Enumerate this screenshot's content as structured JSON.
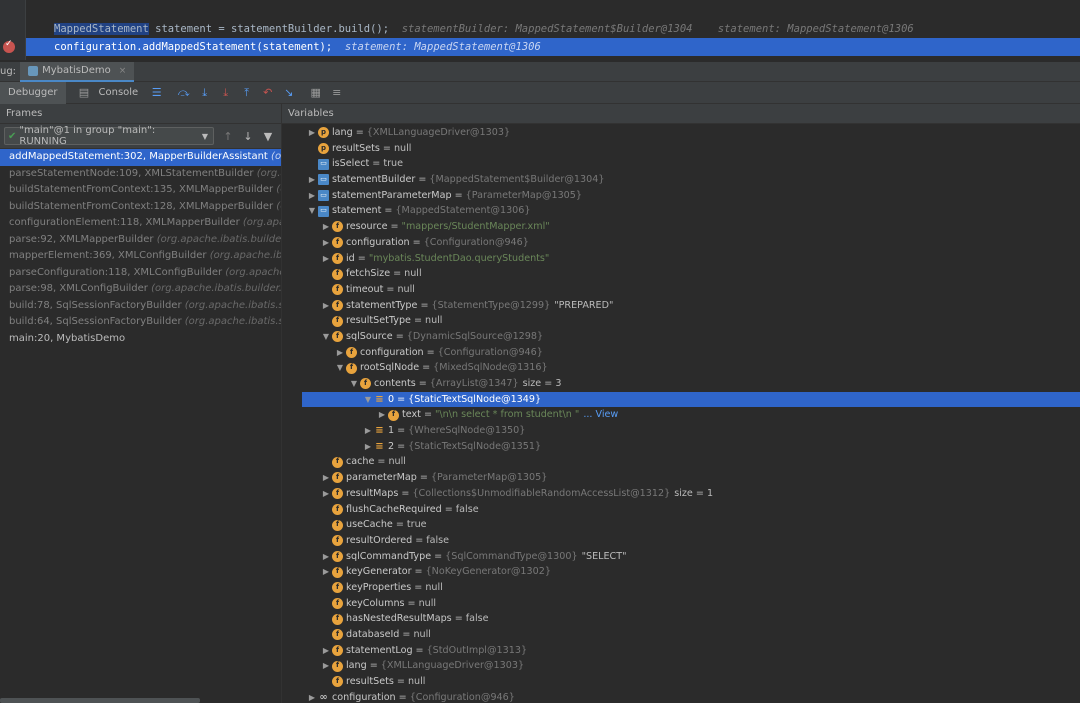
{
  "editor": {
    "line1": {
      "type": "MappedStatement",
      "code": " statement = statementBuilder.build();",
      "hint": "  statementBuilder: MappedStatement$Builder@1304    statement: MappedStatement@1306"
    },
    "line2": {
      "receiver": "configuration",
      "dot": ".",
      "method": "addMappedStatement",
      "args": "(statement);",
      "hint": "  statement: MappedStatement@1306"
    }
  },
  "debug": {
    "label": "ug:",
    "run_tab": "MybatisDemo",
    "close": "×"
  },
  "toolbar": {
    "debugger": "Debugger",
    "console": "Console"
  },
  "frames": {
    "header": "Frames",
    "thread": "\"main\"@1 in group \"main\": RUNNING",
    "items": [
      {
        "method": "addMappedStatement:302, MapperBuilderAssistant",
        "pkg": "(org.ap"
      },
      {
        "method": "parseStatementNode:109, XMLStatementBuilder",
        "pkg": "(org.apach"
      },
      {
        "method": "buildStatementFromContext:135, XMLMapperBuilder",
        "pkg": "(org.a"
      },
      {
        "method": "buildStatementFromContext:128, XMLMapperBuilder",
        "pkg": "(org.a"
      },
      {
        "method": "configurationElement:118, XMLMapperBuilder",
        "pkg": "(org.apache."
      },
      {
        "method": "parse:92, XMLMapperBuilder",
        "pkg": "(org.apache.ibatis.builder.xml"
      },
      {
        "method": "mapperElement:369, XMLConfigBuilder",
        "pkg": "(org.apache.ibatis.b"
      },
      {
        "method": "parseConfiguration:118, XMLConfigBuilder",
        "pkg": "(org.apache.ibat"
      },
      {
        "method": "parse:98, XMLConfigBuilder",
        "pkg": "(org.apache.ibatis.builder.xml)"
      },
      {
        "method": "build:78, SqlSessionFactoryBuilder",
        "pkg": "(org.apache.ibatis.sessio"
      },
      {
        "method": "build:64, SqlSessionFactoryBuilder",
        "pkg": "(org.apache.ibatis.sessio"
      },
      {
        "method": "main:20, MybatisDemo",
        "pkg": ""
      }
    ]
  },
  "variables": {
    "header": "Variables",
    "rows": [
      {
        "name": "lang",
        "value": "{XMLLanguageDriver@1303}"
      },
      {
        "name": "resultSets",
        "value": "null"
      },
      {
        "name": "isSelect",
        "value": "true"
      },
      {
        "name": "statementBuilder",
        "value": "{MappedStatement$Builder@1304}"
      },
      {
        "name": "statementParameterMap",
        "value": "{ParameterMap@1305}"
      },
      {
        "name": "statement",
        "value": "{MappedStatement@1306}"
      },
      {
        "name": "resource",
        "value": "\"mappers/StudentMapper.xml\""
      },
      {
        "name": "configuration",
        "value": "{Configuration@946}"
      },
      {
        "name": "id",
        "value": "\"mybatis.StudentDao.queryStudents\""
      },
      {
        "name": "fetchSize",
        "value": "null"
      },
      {
        "name": "timeout",
        "value": "null"
      },
      {
        "name": "statementType",
        "value": "{StatementType@1299}",
        "extra": "\"PREPARED\""
      },
      {
        "name": "resultSetType",
        "value": "null"
      },
      {
        "name": "sqlSource",
        "value": "{DynamicSqlSource@1298}"
      },
      {
        "name": "configuration",
        "value": "{Configuration@946}"
      },
      {
        "name": "rootSqlNode",
        "value": "{MixedSqlNode@1316}"
      },
      {
        "name": "contents",
        "value": "{ArrayList@1347}",
        "extra": "size = 3"
      },
      {
        "name": "0",
        "value": "{StaticTextSqlNode@1349}"
      },
      {
        "name": "text",
        "value": "\"\\n\\n        select * from student\\n        \"",
        "link": "... View"
      },
      {
        "name": "1",
        "value": "{WhereSqlNode@1350}"
      },
      {
        "name": "2",
        "value": "{StaticTextSqlNode@1351}"
      },
      {
        "name": "cache",
        "value": "null"
      },
      {
        "name": "parameterMap",
        "value": "{ParameterMap@1305}"
      },
      {
        "name": "resultMaps",
        "value": "{Collections$UnmodifiableRandomAccessList@1312}",
        "extra": "size = 1"
      },
      {
        "name": "flushCacheRequired",
        "value": "false"
      },
      {
        "name": "useCache",
        "value": "true"
      },
      {
        "name": "resultOrdered",
        "value": "false"
      },
      {
        "name": "sqlCommandType",
        "value": "{SqlCommandType@1300}",
        "extra": "\"SELECT\""
      },
      {
        "name": "keyGenerator",
        "value": "{NoKeyGenerator@1302}"
      },
      {
        "name": "keyProperties",
        "value": "null"
      },
      {
        "name": "keyColumns",
        "value": "null"
      },
      {
        "name": "hasNestedResultMaps",
        "value": "false"
      },
      {
        "name": "databaseId",
        "value": "null"
      },
      {
        "name": "statementLog",
        "value": "{StdOutImpl@1313}"
      },
      {
        "name": "lang",
        "value": "{XMLLanguageDriver@1303}"
      },
      {
        "name": "resultSets",
        "value": "null"
      },
      {
        "name": "configuration",
        "value": "{Configuration@946}"
      }
    ]
  }
}
